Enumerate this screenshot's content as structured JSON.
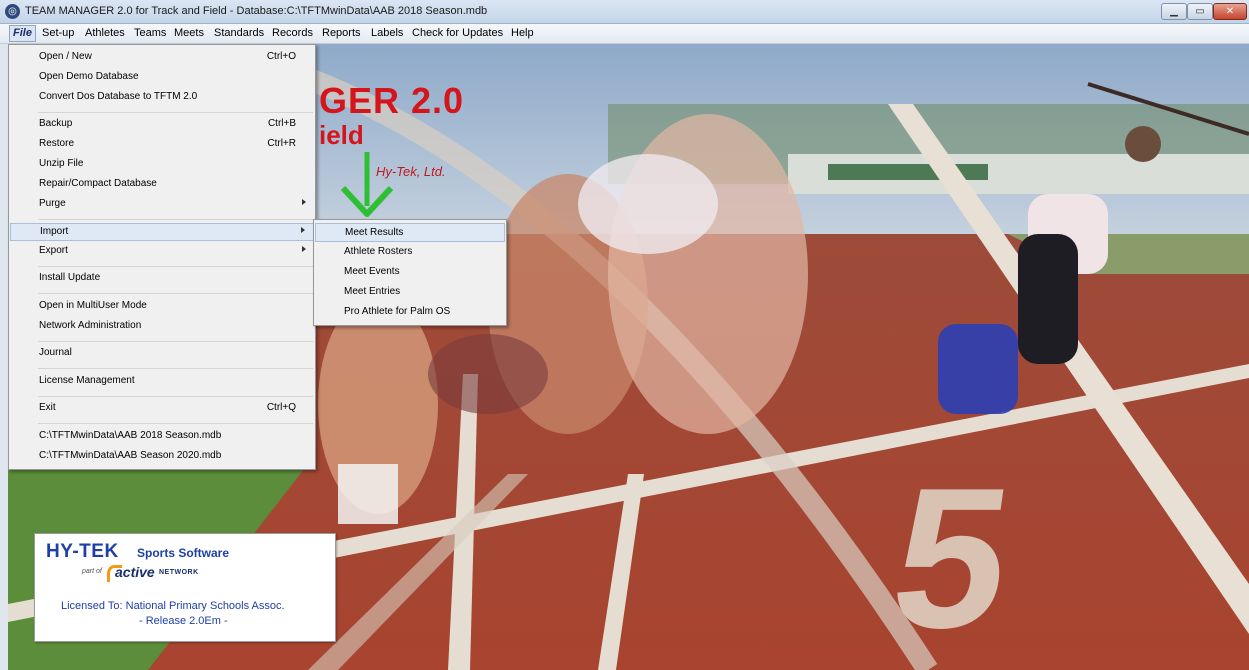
{
  "window": {
    "title": "TEAM MANAGER 2.0 for Track and Field - Database:C:\\TFTMwinData\\AAB 2018 Season.mdb",
    "icon": "app-icon"
  },
  "menubar": [
    {
      "label": "File"
    },
    {
      "label": "Set-up"
    },
    {
      "label": "Athletes"
    },
    {
      "label": "Teams"
    },
    {
      "label": "Meets"
    },
    {
      "label": "Standards"
    },
    {
      "label": "Records"
    },
    {
      "label": "Reports"
    },
    {
      "label": "Labels"
    },
    {
      "label": "Check for Updates"
    },
    {
      "label": "Help"
    }
  ],
  "file_menu": [
    {
      "label": "Open / New",
      "shortcut": "Ctrl+O"
    },
    {
      "label": "Open Demo Database",
      "shortcut": ""
    },
    {
      "label": "Convert Dos Database to TFTM 2.0",
      "shortcut": ""
    },
    {
      "label": "Backup",
      "shortcut": "Ctrl+B"
    },
    {
      "label": "Restore",
      "shortcut": "Ctrl+R"
    },
    {
      "label": "Unzip File",
      "shortcut": ""
    },
    {
      "label": "Repair/Compact Database",
      "shortcut": ""
    },
    {
      "label": "Purge",
      "shortcut": ""
    },
    {
      "label": "Import",
      "shortcut": ""
    },
    {
      "label": "Export",
      "shortcut": ""
    },
    {
      "label": "Install Update",
      "shortcut": ""
    },
    {
      "label": "Open in MultiUser Mode",
      "shortcut": ""
    },
    {
      "label": "Network Administration",
      "shortcut": ""
    },
    {
      "label": "Journal",
      "shortcut": ""
    },
    {
      "label": "License Management",
      "shortcut": ""
    },
    {
      "label": "Exit",
      "shortcut": "Ctrl+Q"
    },
    {
      "label": "C:\\TFTMwinData\\AAB 2018 Season.mdb",
      "shortcut": ""
    },
    {
      "label": "C:\\TFTMwinData\\AAB Season 2020.mdb",
      "shortcut": ""
    }
  ],
  "import_submenu": [
    {
      "label": "Meet Results"
    },
    {
      "label": "Athlete Rosters"
    },
    {
      "label": "Meet Events"
    },
    {
      "label": "Meet Entries"
    },
    {
      "label": "Pro Athlete for Palm OS"
    }
  ],
  "background": {
    "title_partial": "GER 2.0",
    "subtitle_partial": "ield",
    "company_partial": "Hy-Tek, Ltd.",
    "lane_number": "5"
  },
  "license_box": {
    "brand": "HY-TEK",
    "brand_sub": "Sports Software",
    "part_of": "part of",
    "partner": "active",
    "partner_sub": "NETWORK",
    "licensed_to": "Licensed To:  National Primary Schools Assoc.",
    "release": "- Release 2.0Em -"
  },
  "colors": {
    "title_red": "#d4161c",
    "hytek_blue": "#1d3fa8",
    "menu_highlight": "#dfe8f5",
    "track_red": "#a8442f"
  }
}
